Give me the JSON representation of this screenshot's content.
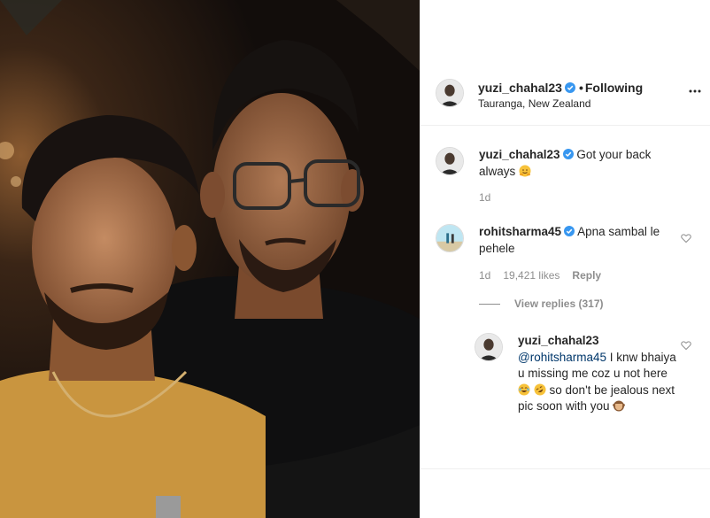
{
  "post": {
    "author": "yuzi_chahal23",
    "follow_state": "Following",
    "separator": "•",
    "location": "Tauranga, New Zealand"
  },
  "comments": [
    {
      "username": "yuzi_chahal23",
      "text": "Got your back always",
      "emoji": "hugging-face",
      "age": "1d"
    },
    {
      "username": "rohitsharma45",
      "text": "Apna sambal le pehele",
      "age": "1d",
      "likes": "19,421 likes",
      "reply_label": "Reply",
      "view_replies": "View replies (317)"
    }
  ],
  "reply": {
    "username": "yuzi_chahal23",
    "mention": "@rohitsharma45",
    "text_part1": "I knw bhaiya u missing me coz u not here",
    "emojis_1": [
      "joy",
      "rofl"
    ],
    "text_part2": "so don't be jealous next pic soon with you",
    "emojis_2": [
      "see-no-evil-monkey"
    ]
  },
  "colors": {
    "verified": "#3897f0",
    "muted": "#8e8e8e",
    "mention": "#00376b",
    "border": "#efefef"
  }
}
